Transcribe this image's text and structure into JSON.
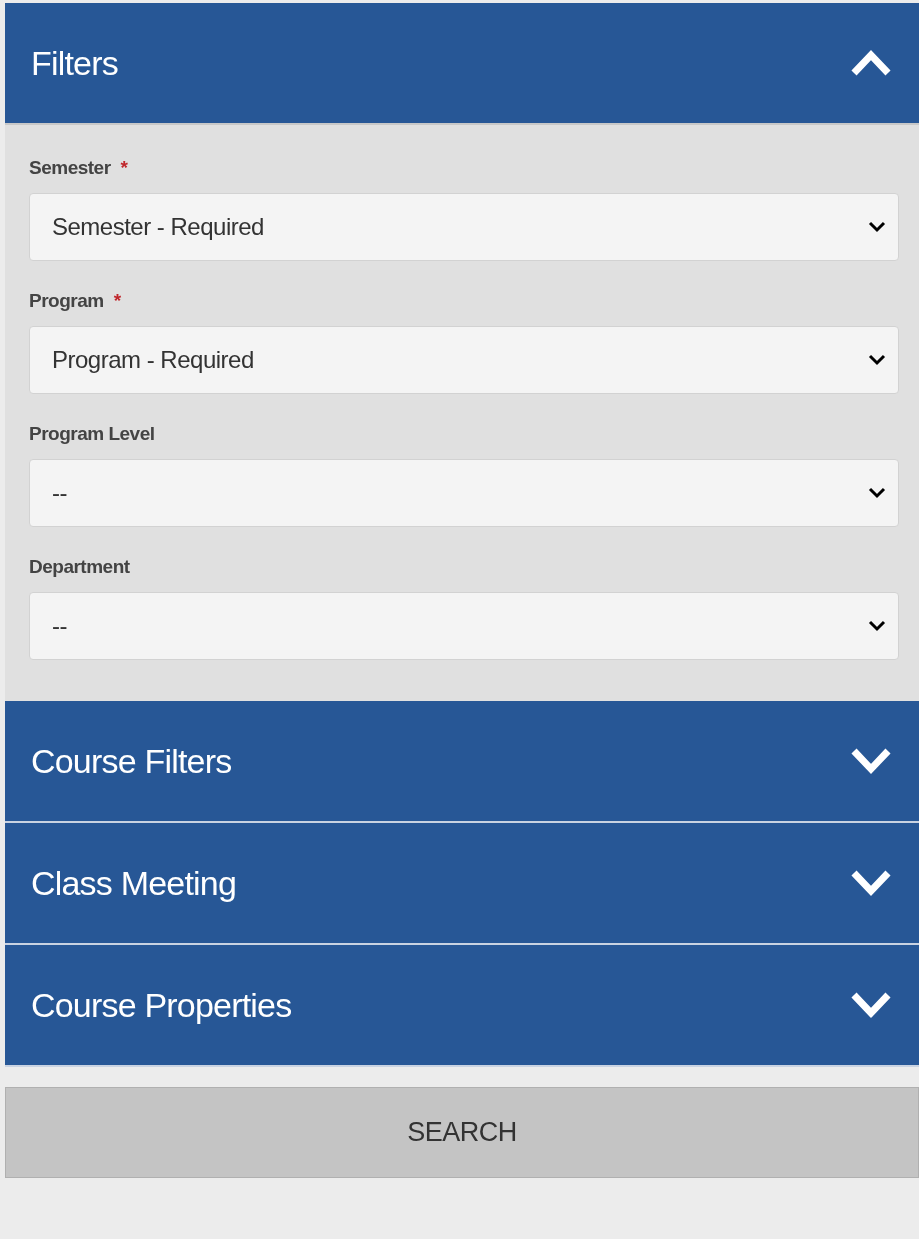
{
  "panels": [
    {
      "title": "Filters",
      "expanded": true,
      "fields": [
        {
          "label": "Semester",
          "required_mark": "*",
          "value": "Semester - Required"
        },
        {
          "label": "Program",
          "required_mark": "*",
          "value": "Program - Required"
        },
        {
          "label": "Program Level",
          "value": "--"
        },
        {
          "label": "Department",
          "value": "--"
        }
      ]
    },
    {
      "title": "Course Filters",
      "expanded": false
    },
    {
      "title": "Class Meeting",
      "expanded": false
    },
    {
      "title": "Course Properties",
      "expanded": false
    }
  ],
  "search_button": "SEARCH"
}
